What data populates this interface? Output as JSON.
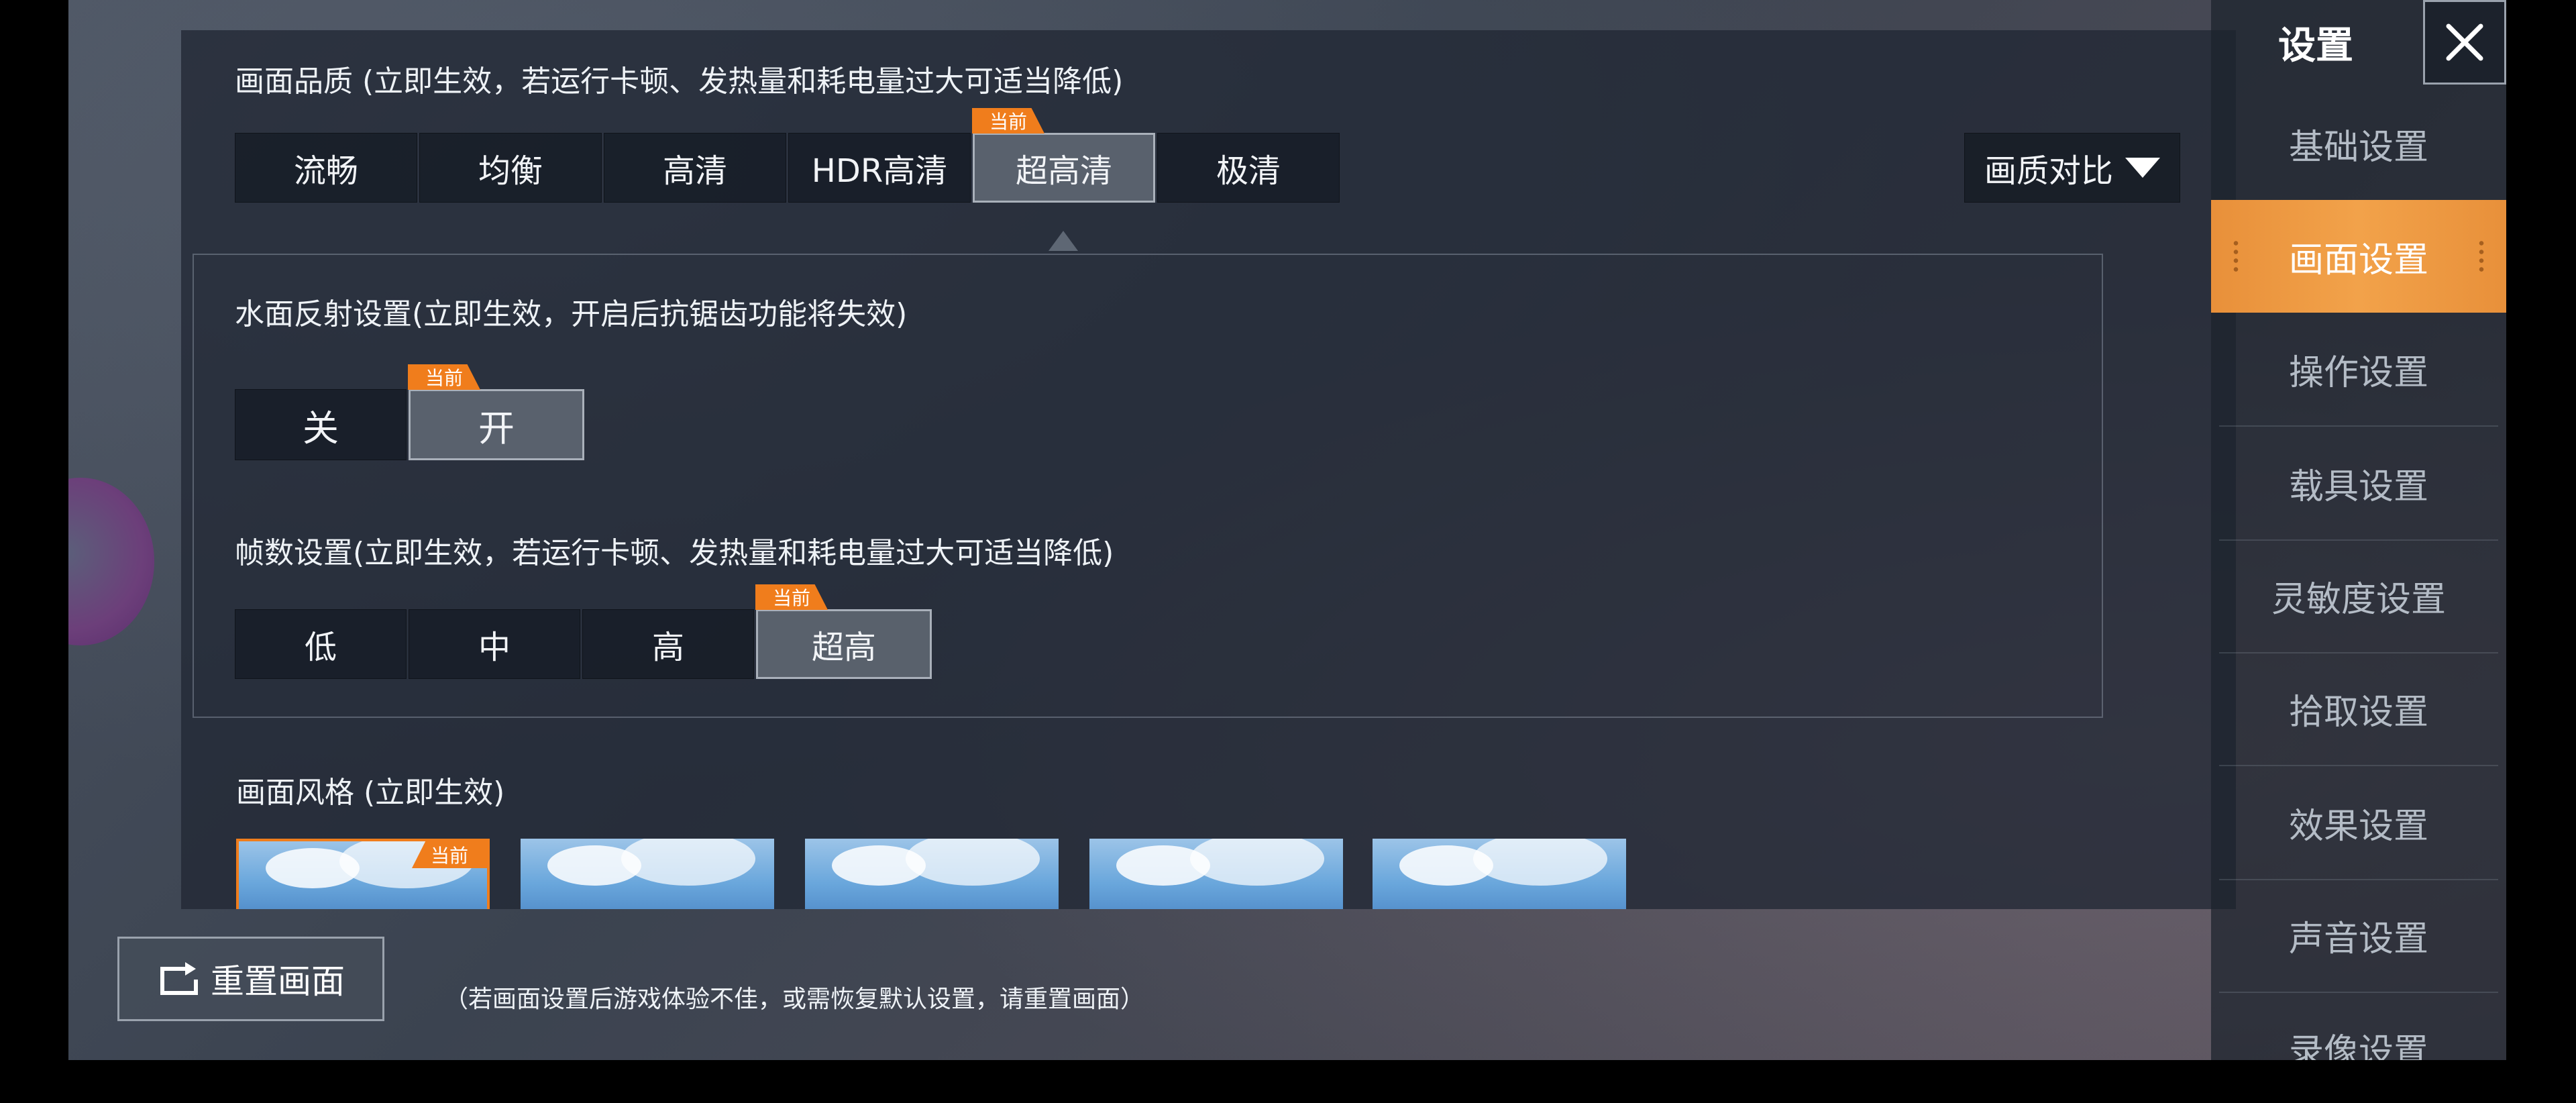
{
  "quality": {
    "title": "画面品质 (立即生效，若运行卡顿、发热量和耗电量过大可适当降低)",
    "options": [
      "流畅",
      "均衡",
      "高清",
      "HDR高清",
      "超高清",
      "极清"
    ],
    "selected": "超高清",
    "current_tag": "当前",
    "compare_label": "画质对比"
  },
  "water": {
    "title": "水面反射设置(立即生效，开启后抗锯齿功能将失效)",
    "options": [
      "关",
      "开"
    ],
    "selected": "开",
    "current_tag": "当前"
  },
  "fps": {
    "title": "帧数设置(立即生效，若运行卡顿、发热量和耗电量过大可适当降低)",
    "options": [
      "低",
      "中",
      "高",
      "超高"
    ],
    "selected": "超高",
    "current_tag": "当前"
  },
  "style": {
    "title": "画面风格 (立即生效)",
    "current_tag": "当前",
    "thumb_count": 5
  },
  "reset": {
    "button_label": "重置画面",
    "note": "（若画面设置后游戏体验不佳，或需恢复默认设置，请重置画面）"
  },
  "sidebar": {
    "title": "设置",
    "items": [
      "基础设置",
      "画面设置",
      "操作设置",
      "载具设置",
      "灵敏度设置",
      "拾取设置",
      "效果设置",
      "声音设置",
      "录像设置"
    ],
    "active": "画面设置"
  },
  "colors": {
    "accent": "#f07d1c",
    "active_nav": "#ee9840"
  },
  "icons": {
    "close": "close-icon",
    "reset": "reset-icon",
    "dropdown": "triangle-down-icon",
    "float_ball": "gamepad-float-icon"
  }
}
